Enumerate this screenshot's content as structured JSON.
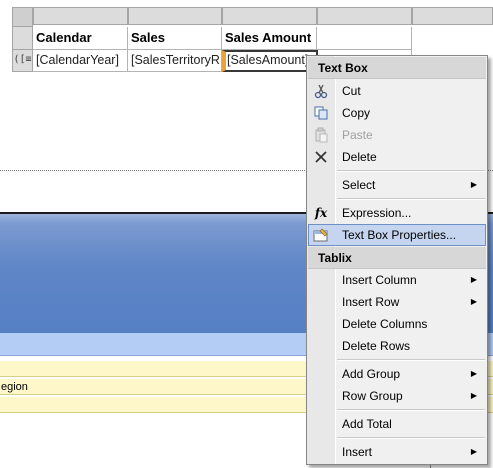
{
  "tablix": {
    "headers": [
      "Calendar",
      "Sales",
      "Sales Amount",
      ""
    ],
    "details": [
      "[CalendarYear]",
      "[SalesTerritoryR",
      "[SalesAmount]",
      ""
    ],
    "row_group_glyph": "([≡"
  },
  "preview": {
    "region_text": "egion"
  },
  "context_menu": {
    "section1_title": "Text Box",
    "cut": "Cut",
    "copy": "Copy",
    "paste": "Paste",
    "delete": "Delete",
    "select": "Select",
    "expression": "Expression...",
    "textbox_properties": "Text Box Properties...",
    "section2_title": "Tablix",
    "insert_column": "Insert Column",
    "insert_row": "Insert Row",
    "delete_columns": "Delete Columns",
    "delete_rows": "Delete Rows",
    "add_group": "Add Group",
    "row_group": "Row Group",
    "add_total": "Add Total",
    "insert": "Insert",
    "submenu_arrow": "▶"
  },
  "icons": {
    "cut": "scissors-icon",
    "copy": "copy-icon",
    "paste": "paste-icon",
    "delete": "delete-x-icon",
    "expression": "fx-icon",
    "properties": "textbox-properties-icon"
  },
  "colors": {
    "menu_highlight": "#c6d5ef",
    "preview_blue": "#5f86c7",
    "selection_accent": "#e8a33a"
  }
}
